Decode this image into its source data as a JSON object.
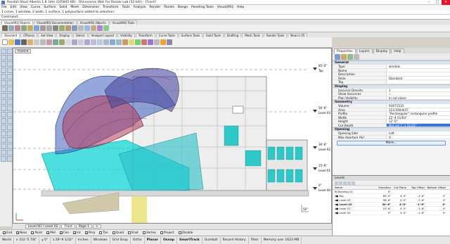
{
  "window": {
    "title": "Randall Stout Alberta 1.8.3dm (105845 KB) - Rhinoceros (Not For Resale Lab (32-bit)) - [Front]",
    "min": "–",
    "max": "□",
    "close": "✕"
  },
  "menu": [
    "File",
    "Edit",
    "View",
    "Curve",
    "Surface",
    "Solid",
    "Mesh",
    "Dimension",
    "Transform",
    "Tools",
    "Analyze",
    "Render",
    "Panels",
    "Bongo",
    "Paneling Tools",
    "VisualARQ",
    "Help"
  ],
  "command_history": "1 curve, 1 window, 2 walls, 1 surface, 1 polysurface added to selection.",
  "command_prompt": "Command:",
  "toolbar_tabs_1": [
    "VisualARQ Objects",
    "VisualARQ Documentation",
    "VisualARQ Objects",
    "VisualARQ Tools"
  ],
  "toolbar_tabs_2": [
    "Standard",
    "CPlanes",
    "Set View",
    "Display",
    "Select",
    "Viewport Layout",
    "Visibility",
    "Transform",
    "Curve Tools",
    "Surface Tools",
    "Solid Tools",
    "Drafting",
    "Mesh Tools",
    "Render Tools",
    "New in V5"
  ],
  "viewport": {
    "label": "Front ▾",
    "levels": [
      {
        "name": "Top",
        "elev": "85'-0\""
      },
      {
        "name": "Level 03",
        "elev": "56'-6\""
      },
      {
        "name": "Level 02",
        "elev": "30'-6\""
      },
      {
        "name": "Level 01",
        "elev": "15'-6\""
      },
      {
        "name": "Level 00",
        "elev": "0\""
      }
    ],
    "angle_label": "56°"
  },
  "viewport_tabs": [
    "Level 00 / Level 02",
    "Front",
    "Page 1",
    "+"
  ],
  "osnap": [
    {
      "label": "End",
      "checked": true
    },
    {
      "label": "Near",
      "checked": true
    },
    {
      "label": "Point",
      "checked": true
    },
    {
      "label": "Mid",
      "checked": true
    },
    {
      "label": "Cen",
      "checked": true
    },
    {
      "label": "Int",
      "checked": true
    },
    {
      "label": "Perp",
      "checked": true
    },
    {
      "label": "Tan",
      "checked": false
    },
    {
      "label": "Quad",
      "checked": false
    },
    {
      "label": "Knot",
      "checked": false
    },
    {
      "label": "Vertex",
      "checked": false
    },
    {
      "label": "Project",
      "checked": false
    },
    {
      "label": "Disable",
      "checked": false
    }
  ],
  "status": {
    "cplane": "World",
    "x": "x 312'-5 7/8\"",
    "y": "y 0\"",
    "z": "z 28'-9 1/32\"",
    "units": "Inches",
    "layer": "Windows",
    "grid_snap": "Grid Snap",
    "ortho": "Ortho",
    "planar": "Planar",
    "osnap": "Osnap",
    "smarttrack": "SmartTrack",
    "gumball": "Gumball",
    "record_history": "Record History",
    "filter": "Filter",
    "memory": "Memory use: 1623 MB"
  },
  "panel": {
    "tabs": [
      "Properties",
      "Layers",
      "Display",
      "Help"
    ],
    "general_title": "General",
    "general": [
      {
        "k": "Type",
        "v": "window"
      },
      {
        "k": "Name",
        "v": ""
      },
      {
        "k": "Description",
        "v": ""
      },
      {
        "k": "Style",
        "v": "Standard"
      },
      {
        "k": "Tag",
        "v": ""
      }
    ],
    "display_title": "Display",
    "display": [
      {
        "k": "Isocurve Density",
        "v": "1"
      },
      {
        "k": "Show Isocurves",
        "v": "✓"
      },
      {
        "k": "Plan Visibility",
        "v": "In cut plane"
      }
    ],
    "geometry_title": "Geometry",
    "geometry": [
      {
        "k": "Volume",
        "v": "93671515"
      },
      {
        "k": "Area",
        "v": "223.0564437"
      },
      {
        "k": "Profile",
        "v": "\"Rectangular\" rectangular profile"
      },
      {
        "k": "Width",
        "v": "22'-4 51/64\""
      },
      {
        "k": "Height",
        "v": "12'-0\""
      },
      {
        "k": "Cut Depth",
        "v": "Not set 1'-1 51/32\""
      }
    ],
    "opening_title": "Opening",
    "opening": [
      {
        "k": "Opening Side",
        "v": "Left"
      },
      {
        "k": "Max Aperture (%)",
        "v": "0"
      }
    ],
    "more": "More..."
  },
  "levels_panel": {
    "title": "Levels",
    "columns": [
      "Name",
      "Elevation",
      "Cut Plane",
      "Top Offset",
      "Bottom Offset"
    ],
    "rows": [
      {
        "name": "⊟ Building 01",
        "elev": "0\"",
        "cut": "",
        "top": "",
        "bottom": "",
        "bold": false
      },
      {
        "name": "  ◂● Top",
        "elev": "85'-0\"",
        "cut": "4'-0\"",
        "top": "-1'-6\"",
        "bottom": "0\"",
        "bold": false
      },
      {
        "name": "  ◂● Level 03",
        "elev": "56'-6\"",
        "cut": "4'-0\"",
        "top": "-1'-6\"",
        "bottom": "0\"",
        "bold": false
      },
      {
        "name": "  ◂● Level 02",
        "elev": "30'-6\"",
        "cut": "4'-0\"",
        "top": "-1'-6\"",
        "bottom": "0\"",
        "bold": true
      },
      {
        "name": "  ◂● Level 01",
        "elev": "15'-6\"",
        "cut": "4'-0\"",
        "top": "-1'-6\"",
        "bottom": "0\"",
        "bold": false
      },
      {
        "name": "  ◂● Level 00",
        "elev": "0\"",
        "cut": "4'-0\"",
        "top": "-1'-6\"",
        "bottom": "0\"",
        "bold": false
      }
    ]
  }
}
